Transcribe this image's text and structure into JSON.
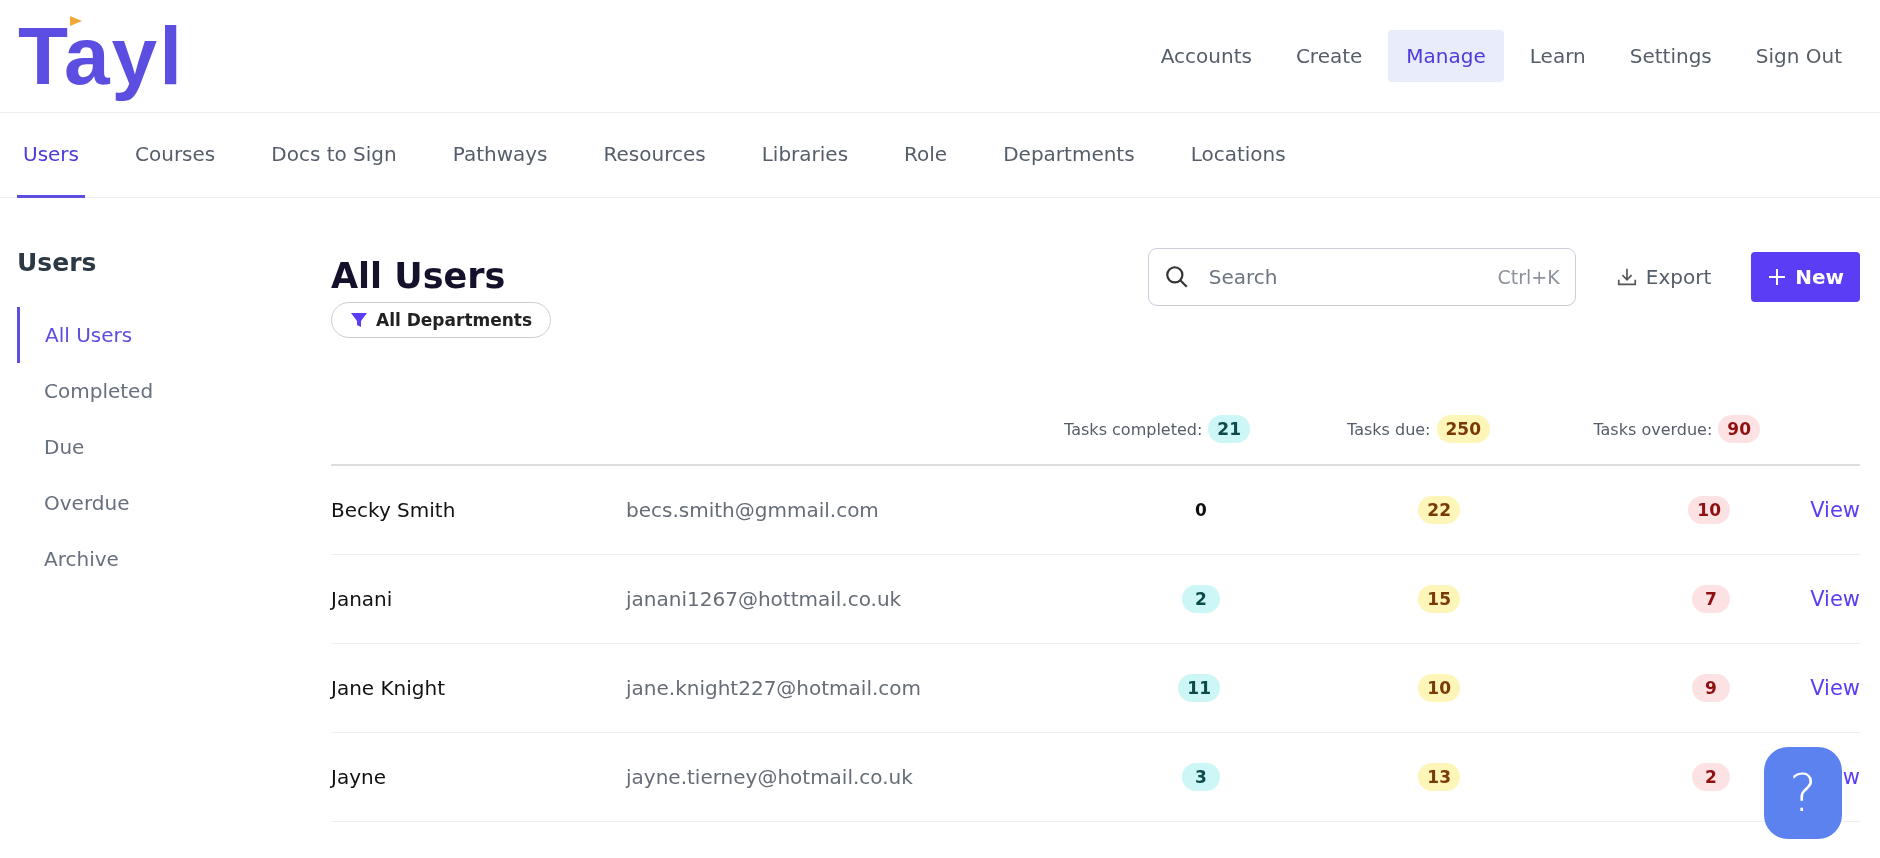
{
  "logo": {
    "text": "Tayl"
  },
  "nav": [
    {
      "label": "Accounts",
      "selected": false
    },
    {
      "label": "Create",
      "selected": false
    },
    {
      "label": "Manage",
      "selected": true
    },
    {
      "label": "Learn",
      "selected": false
    },
    {
      "label": "Settings",
      "selected": false
    },
    {
      "label": "Sign Out",
      "selected": false
    }
  ],
  "tabs": [
    {
      "label": "Users",
      "selected": true
    },
    {
      "label": "Courses",
      "selected": false
    },
    {
      "label": "Docs to Sign",
      "selected": false
    },
    {
      "label": "Pathways",
      "selected": false
    },
    {
      "label": "Resources",
      "selected": false
    },
    {
      "label": "Libraries",
      "selected": false
    },
    {
      "label": "Role",
      "selected": false
    },
    {
      "label": "Departments",
      "selected": false
    },
    {
      "label": "Locations",
      "selected": false
    }
  ],
  "sidebar": {
    "title": "Users",
    "items": [
      {
        "label": "All Users",
        "selected": true
      },
      {
        "label": "Completed",
        "selected": false
      },
      {
        "label": "Due",
        "selected": false
      },
      {
        "label": "Overdue",
        "selected": false
      },
      {
        "label": "Archive",
        "selected": false
      }
    ]
  },
  "main": {
    "title": "All Users",
    "filter": "All Departments",
    "search": {
      "placeholder": "Search",
      "shortcut": "Ctrl+K"
    },
    "export": "Export",
    "new": "New",
    "summary": [
      {
        "kind": "completed",
        "label": "Tasks completed:",
        "value": "21"
      },
      {
        "kind": "due",
        "label": "Tasks due:",
        "value": "250"
      },
      {
        "kind": "overdue",
        "label": "Tasks overdue:",
        "value": "90"
      }
    ],
    "rows": [
      {
        "name": "Becky Smith",
        "email": "becs.smith@gmmail.com",
        "completed": {
          "value": "0",
          "badge": false
        },
        "due": {
          "value": "22",
          "badge": true
        },
        "overdue": {
          "value": "10",
          "badge": true
        },
        "action": "View"
      },
      {
        "name": "Janani",
        "email": "janani1267@hottmail.co.uk",
        "completed": {
          "value": "2",
          "badge": true
        },
        "due": {
          "value": "15",
          "badge": true
        },
        "overdue": {
          "value": "7",
          "badge": true
        },
        "action": "View"
      },
      {
        "name": "Jane Knight",
        "email": "jane.knight227@hotmail.com",
        "completed": {
          "value": "11",
          "badge": true
        },
        "due": {
          "value": "10",
          "badge": true
        },
        "overdue": {
          "value": "9",
          "badge": true
        },
        "action": "View"
      },
      {
        "name": "Jayne",
        "email": "jayne.tierney@hotmail.co.uk",
        "completed": {
          "value": "3",
          "badge": true
        },
        "due": {
          "value": "13",
          "badge": true
        },
        "overdue": {
          "value": "2",
          "badge": true
        },
        "action": "w"
      }
    ]
  },
  "help": {
    "label": "?"
  }
}
